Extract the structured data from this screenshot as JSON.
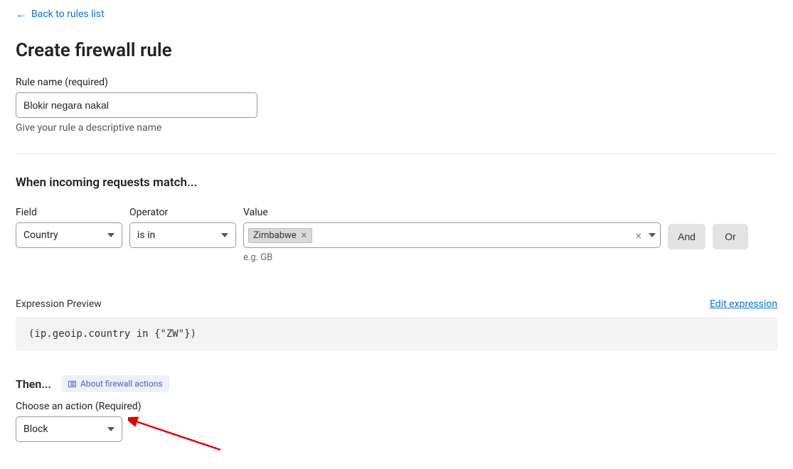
{
  "back_link": "Back to rules list",
  "page_title": "Create firewall rule",
  "rule_name": {
    "label": "Rule name (required)",
    "value": "Blokir negara nakal",
    "helper": "Give your rule a descriptive name"
  },
  "match_section": {
    "title": "When incoming requests match...",
    "headers": {
      "field": "Field",
      "operator": "Operator",
      "value": "Value"
    },
    "field_value": "Country",
    "operator_value": "is in",
    "tags": [
      "Zimbabwe"
    ],
    "value_helper": "e.g. GB",
    "and_label": "And",
    "or_label": "Or"
  },
  "preview": {
    "title": "Expression Preview",
    "edit_link": "Edit expression",
    "code": "(ip.geoip.country in {\"ZW\"})"
  },
  "then_section": {
    "title": "Then...",
    "about_label": "About firewall actions",
    "action_label": "Choose an action (Required)",
    "action_value": "Block"
  }
}
